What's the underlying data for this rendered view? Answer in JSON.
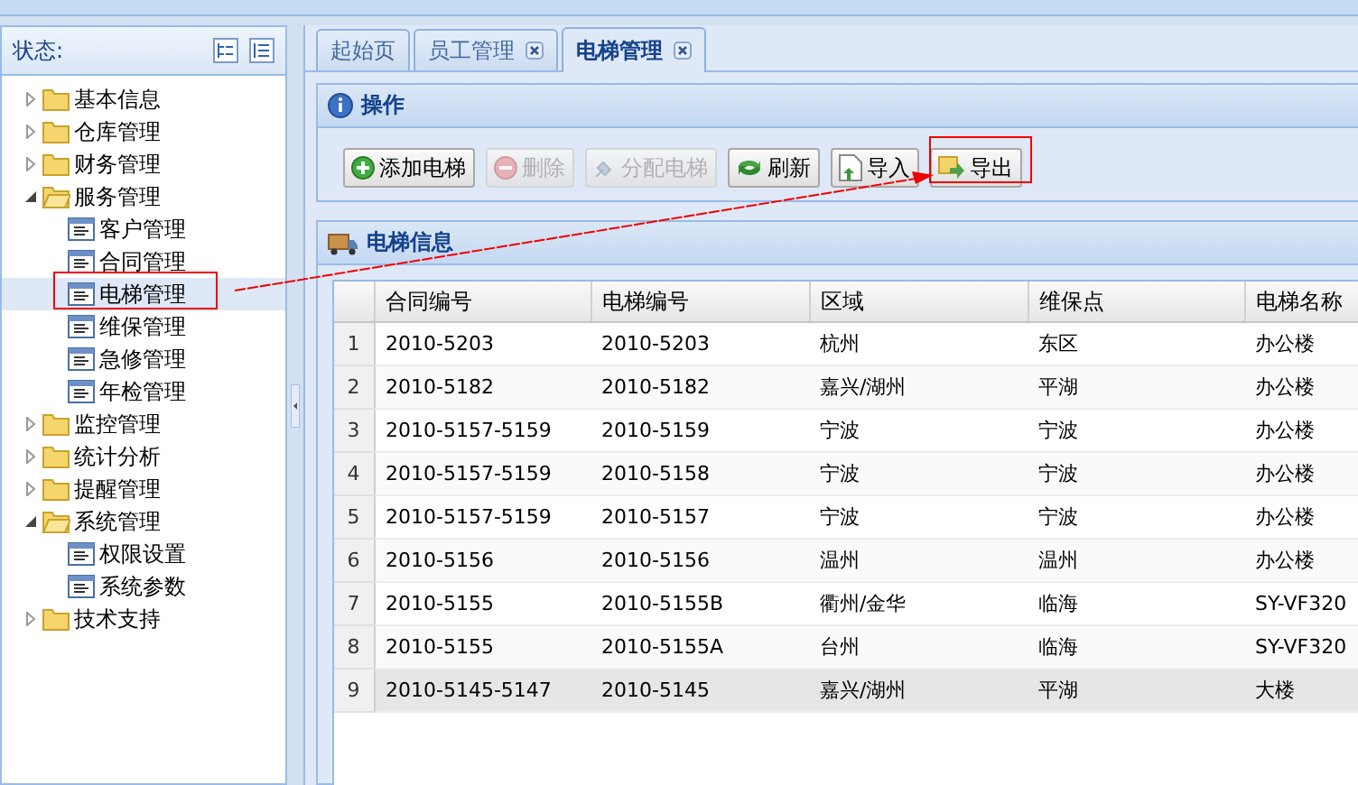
{
  "sidebar": {
    "title": "状态:",
    "tree": [
      {
        "kind": "folder",
        "label": "基本信息",
        "expanded": false
      },
      {
        "kind": "folder",
        "label": "仓库管理",
        "expanded": false
      },
      {
        "kind": "folder",
        "label": "财务管理",
        "expanded": false
      },
      {
        "kind": "folder",
        "label": "服务管理",
        "expanded": true,
        "children": [
          {
            "kind": "page",
            "label": "客户管理",
            "selected": false
          },
          {
            "kind": "page",
            "label": "合同管理",
            "selected": false
          },
          {
            "kind": "page",
            "label": "电梯管理",
            "selected": true
          },
          {
            "kind": "page",
            "label": "维保管理",
            "selected": false
          },
          {
            "kind": "page",
            "label": "急修管理",
            "selected": false
          },
          {
            "kind": "page",
            "label": "年检管理",
            "selected": false
          }
        ]
      },
      {
        "kind": "folder",
        "label": "监控管理",
        "expanded": false
      },
      {
        "kind": "folder",
        "label": "统计分析",
        "expanded": false
      },
      {
        "kind": "folder",
        "label": "提醒管理",
        "expanded": false
      },
      {
        "kind": "folder",
        "label": "系统管理",
        "expanded": true,
        "children": [
          {
            "kind": "page",
            "label": "权限设置",
            "selected": false
          },
          {
            "kind": "page",
            "label": "系统参数",
            "selected": false
          }
        ]
      },
      {
        "kind": "folder",
        "label": "技术支持",
        "expanded": false
      }
    ]
  },
  "tabs": [
    {
      "label": "起始页",
      "selected": false,
      "closable": false
    },
    {
      "label": "员工管理",
      "selected": false,
      "closable": true
    },
    {
      "label": "电梯管理",
      "selected": true,
      "closable": true
    }
  ],
  "operations": {
    "title": "操作",
    "buttons": [
      {
        "kind": "add",
        "label": "添加电梯",
        "disabled": false
      },
      {
        "kind": "delete",
        "label": "删除",
        "disabled": true
      },
      {
        "kind": "assign",
        "label": "分配电梯",
        "disabled": true
      },
      {
        "kind": "refresh",
        "label": "刷新",
        "disabled": false
      },
      {
        "kind": "import",
        "label": "导入",
        "disabled": false
      },
      {
        "kind": "export",
        "label": "导出",
        "disabled": false
      }
    ]
  },
  "elevator_info": {
    "title": "电梯信息",
    "table": {
      "columns": [
        "合同编号",
        "电梯编号",
        "区域",
        "维保点",
        "电梯名称"
      ],
      "rows": [
        {
          "index": "1",
          "cells": [
            "2010-5203",
            "2010-5203",
            "杭州",
            "东区",
            "办公楼"
          ],
          "selected": false
        },
        {
          "index": "2",
          "cells": [
            "2010-5182",
            "2010-5182",
            "嘉兴/湖州",
            "平湖",
            "办公楼"
          ],
          "selected": false
        },
        {
          "index": "3",
          "cells": [
            "2010-5157-5159",
            "2010-5159",
            "宁波",
            "宁波",
            "办公楼"
          ],
          "selected": false
        },
        {
          "index": "4",
          "cells": [
            "2010-5157-5159",
            "2010-5158",
            "宁波",
            "宁波",
            "办公楼"
          ],
          "selected": false
        },
        {
          "index": "5",
          "cells": [
            "2010-5157-5159",
            "2010-5157",
            "宁波",
            "宁波",
            "办公楼"
          ],
          "selected": false
        },
        {
          "index": "6",
          "cells": [
            "2010-5156",
            "2010-5156",
            "温州",
            "温州",
            "办公楼"
          ],
          "selected": false
        },
        {
          "index": "7",
          "cells": [
            "2010-5155",
            "2010-5155B",
            "衢州/金华",
            "临海",
            "SY-VF320"
          ],
          "selected": false
        },
        {
          "index": "8",
          "cells": [
            "2010-5155",
            "2010-5155A",
            "台州",
            "临海",
            "SY-VF320"
          ],
          "selected": false
        },
        {
          "index": "9",
          "cells": [
            "2010-5145-5147",
            "2010-5145",
            "嘉兴/湖州",
            "平湖",
            "大楼"
          ],
          "selected": true
        }
      ]
    }
  }
}
